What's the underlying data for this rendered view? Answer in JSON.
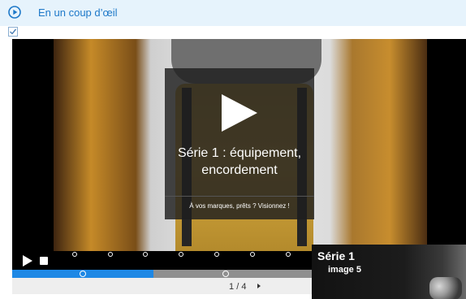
{
  "header": {
    "title": "En un coup d’œil",
    "icon": "play-circle-icon",
    "accent": "#1d78c8"
  },
  "video": {
    "title": "Série 1 : équipement, encordement",
    "tagline": "À vos marques, prêts ? Visionnez !",
    "progress_fraction": 0.47
  },
  "pager": {
    "current": "1",
    "separator": "/",
    "total": "4"
  },
  "thumbnail": {
    "title": "Série 1",
    "subtitle": "image 5"
  }
}
